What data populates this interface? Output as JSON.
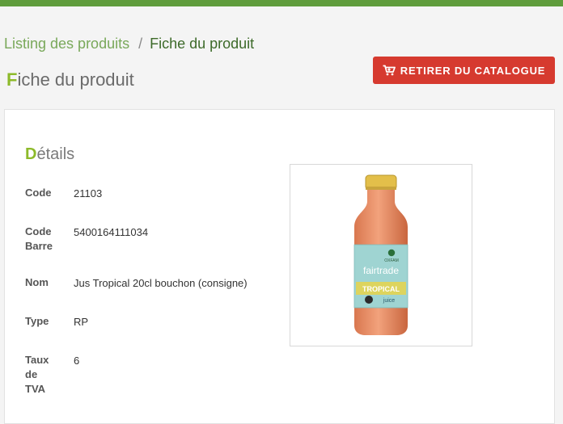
{
  "breadcrumb": {
    "parent": "Listing des produits",
    "separator": "/",
    "current": "Fiche du produit"
  },
  "page_title": {
    "first_letter": "F",
    "rest": "iche du produit"
  },
  "action_button": {
    "label": "RETIRER DU CATALOGUE",
    "icon": "cart-icon",
    "color": "#d63a2f"
  },
  "details": {
    "title_first_letter": "D",
    "title_rest": "étails",
    "fields": [
      {
        "label": "Code",
        "value": "21103"
      },
      {
        "label": "Code Barre",
        "value": "5400164111034"
      },
      {
        "label": "Nom",
        "value": "Jus Tropical 20cl bouchon (consigne)"
      },
      {
        "label": "Type",
        "value": "RP"
      },
      {
        "label": "Taux de TVA",
        "value": "6"
      }
    ]
  },
  "product_image": {
    "label_brand": "fairtrade",
    "label_top": "OXFAM",
    "label_flavor": "TROPICAL",
    "label_sub": "juice"
  },
  "colors": {
    "accent_green": "#5f9c3c",
    "title_letter": "#8dba2a",
    "button_red": "#d63a2f"
  }
}
